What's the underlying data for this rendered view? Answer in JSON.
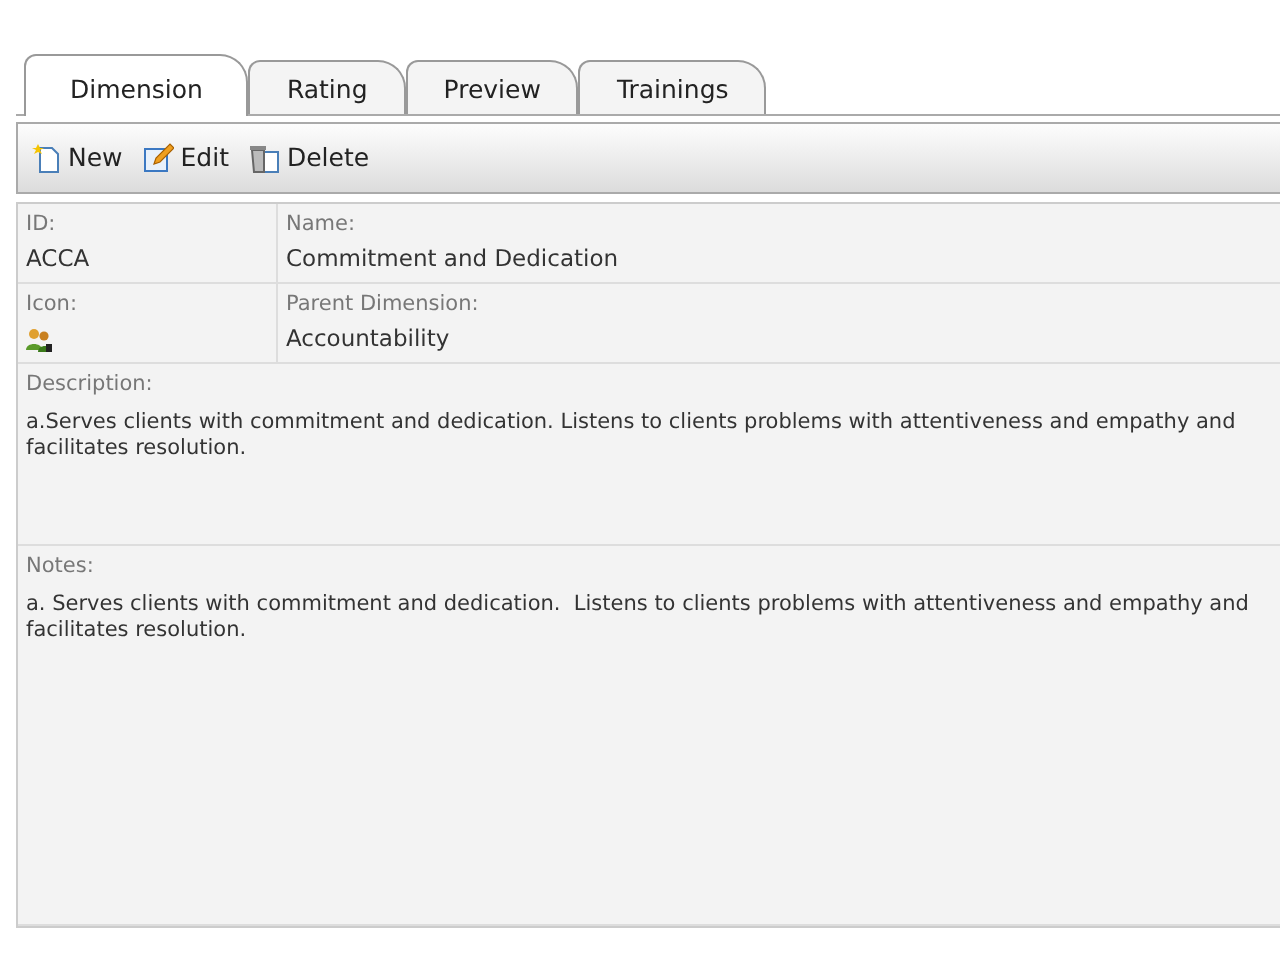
{
  "tabs": [
    {
      "label": "Dimension",
      "selected": true
    },
    {
      "label": "Rating",
      "selected": false
    },
    {
      "label": "Preview",
      "selected": false
    },
    {
      "label": "Trainings",
      "selected": false
    }
  ],
  "toolbar": [
    {
      "label": "New",
      "kind": "new"
    },
    {
      "label": "Edit",
      "kind": "edit"
    },
    {
      "label": "Delete",
      "kind": "delete"
    }
  ],
  "fields": [
    {
      "label": "ID:",
      "value": "ACCA"
    },
    {
      "label": "Name:",
      "value": "Commitment and Dedication"
    },
    {
      "label": "Icon:",
      "kind": "icon"
    },
    {
      "label": "Parent Dimension:",
      "value": "Accountability"
    }
  ],
  "description": {
    "label": "Description:",
    "value": "a.Serves clients with commitment and dedication. Listens to clients problems with attentiveness and empathy and facilitates resolution."
  },
  "notes": {
    "label": "Notes:",
    "value": "a. Serves clients with commitment and dedication.  Listens to clients problems with attentiveness and empathy and facilitates resolution."
  }
}
